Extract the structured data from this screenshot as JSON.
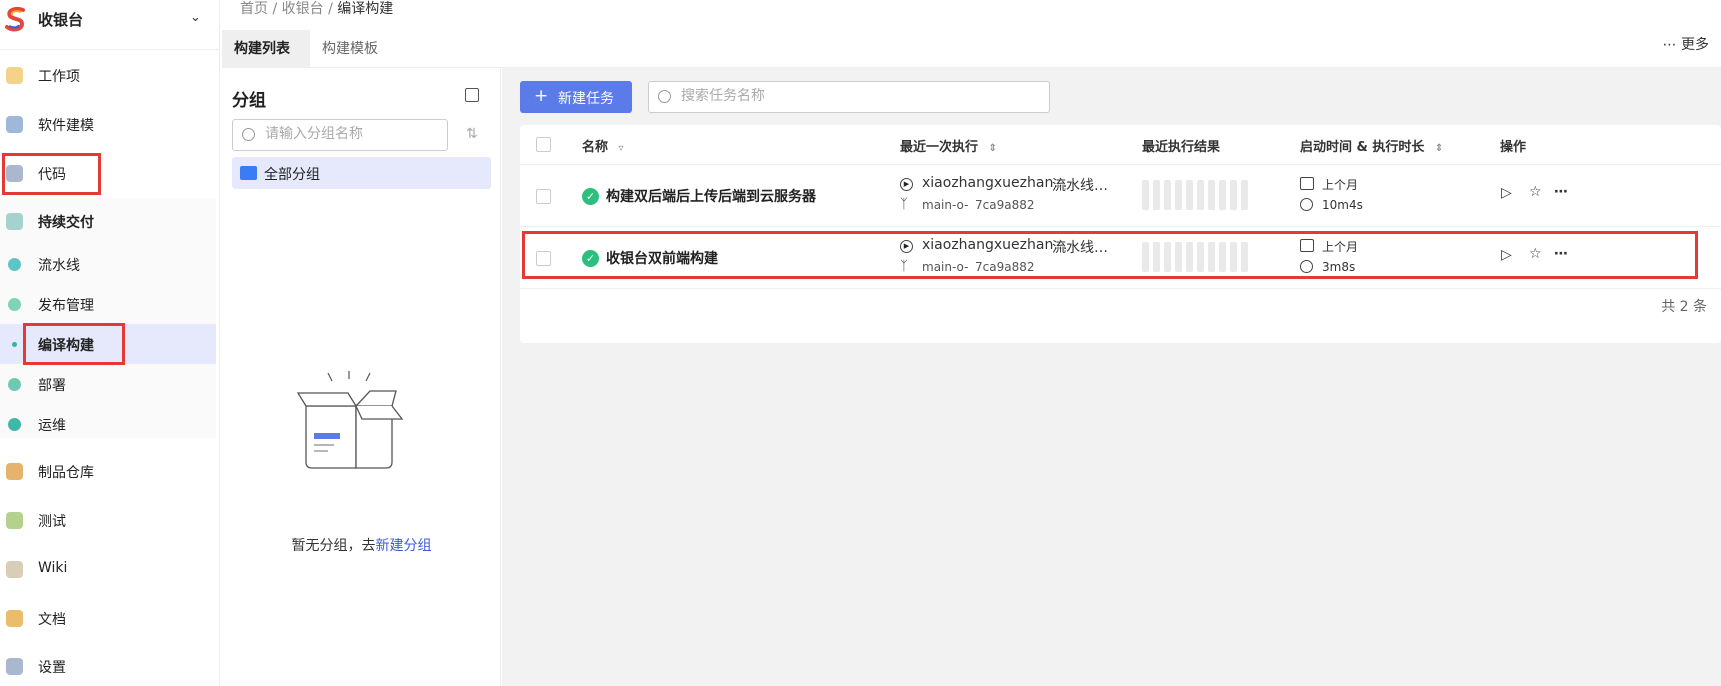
{
  "app": {
    "name": "收银台"
  },
  "sidebar": {
    "items": [
      {
        "label": "工作项"
      },
      {
        "label": "软件建模"
      },
      {
        "label": "代码"
      },
      {
        "label": "持续交付"
      },
      {
        "label": "流水线"
      },
      {
        "label": "发布管理"
      },
      {
        "label": "编译构建"
      },
      {
        "label": "部署"
      },
      {
        "label": "运维"
      },
      {
        "label": "制品仓库"
      },
      {
        "label": "测试"
      },
      {
        "label": "Wiki"
      },
      {
        "label": "文档"
      },
      {
        "label": "设置"
      }
    ]
  },
  "breadcrumb": {
    "items": [
      "首页",
      "收银台",
      "编译构建"
    ],
    "separator": "/"
  },
  "tabs": {
    "list": "构建列表",
    "template": "构建模板"
  },
  "more_label": "更多",
  "groups": {
    "title": "分组",
    "search_placeholder": "请输入分组名称",
    "all_label": "全部分组",
    "empty_text": "暂无分组，去",
    "empty_link": "新建分组"
  },
  "toolbar": {
    "new_task_label": "新建任务",
    "search_placeholder": "搜索任务名称"
  },
  "table": {
    "columns": {
      "name": "名称",
      "last_run": "最近一次执行",
      "last_result": "最近执行结果",
      "time": "启动时间 & 执行时长",
      "ops": "操作"
    },
    "rows": [
      {
        "name": "构建双后端后上传后端到云服务器",
        "repo": "xiaozhangxuezhan…",
        "pipeline": "流水线…",
        "branch": "main",
        "commit": "7ca9a882",
        "when": "上个月",
        "duration": "10m4s",
        "status": "success"
      },
      {
        "name": "收银台双前端构建",
        "repo": "xiaozhangxuezhan…",
        "pipeline": "流水线…",
        "branch": "main",
        "commit": "7ca9a882",
        "when": "上个月",
        "duration": "3m8s",
        "status": "success"
      }
    ],
    "total_label": "共 2 条"
  },
  "colors": {
    "accent": "#5b7be8",
    "success": "#2cbf7e",
    "highlight": "#e53935",
    "active_bg": "#e6e9fb"
  }
}
